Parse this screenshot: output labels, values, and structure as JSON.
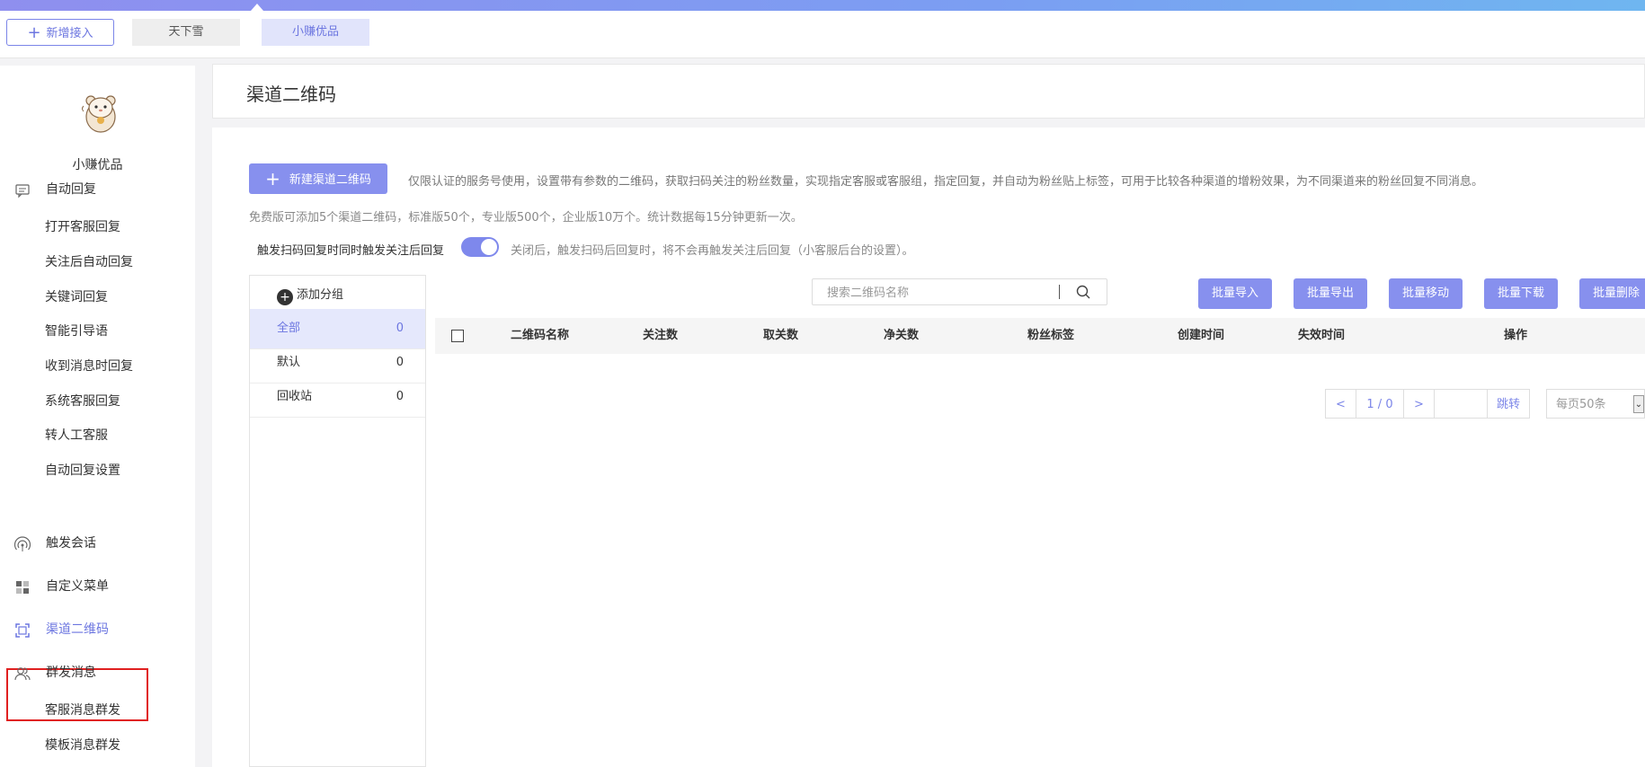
{
  "tabs": {
    "add_label": "新增接入",
    "items": [
      {
        "label": "天下雪"
      },
      {
        "label": "小赚优品"
      }
    ]
  },
  "sidebar": {
    "account_name": "小赚优品",
    "sections": [
      {
        "label": "自动回复",
        "icon": "chat-bubble-icon"
      },
      {
        "label": "触发会话",
        "icon": "broadcast-signal-icon"
      },
      {
        "label": "自定义菜单",
        "icon": "grid-menu-icon"
      },
      {
        "label": "渠道二维码",
        "icon": "qr-scan-icon"
      },
      {
        "label": "群发消息",
        "icon": "users-icon"
      }
    ],
    "auto_reply_items": [
      "打开客服回复",
      "关注后自动回复",
      "关键词回复",
      "智能引导语",
      "收到消息时回复",
      "系统客服回复",
      "转人工客服",
      "自动回复设置"
    ],
    "mass_items": [
      "客服消息群发",
      "模板消息群发"
    ]
  },
  "page": {
    "title": "渠道二维码",
    "new_button": "新建渠道二维码",
    "desc1": "仅限认证的服务号使用，设置带有参数的二维码，获取扫码关注的粉丝数量，实现指定客服或客服组，指定回复，并自动为粉丝贴上标签，可用于比较各种渠道的增粉效果，为不同渠道来的粉丝回复不同消息。",
    "desc2": "免费版可添加5个渠道二维码，标准版50个，专业版500个，企业版10万个。统计数据每15分钟更新一次。",
    "toggle_label": "触发扫码回复时同时触发关注后回复",
    "toggle_on": true,
    "toggle_note": "关闭后，触发扫码后回复时，将不会再触发关注后回复（小客服后台的设置）。"
  },
  "groups": {
    "add_label": "添加分组",
    "items": [
      {
        "name": "全部",
        "count": "0"
      },
      {
        "name": "默认",
        "count": "0"
      },
      {
        "name": "回收站",
        "count": "0"
      }
    ]
  },
  "search": {
    "placeholder": "搜索二维码名称",
    "value": ""
  },
  "batch_buttons": [
    "批量导入",
    "批量导出",
    "批量移动",
    "批量下载",
    "批量删除"
  ],
  "table": {
    "columns": [
      "二维码名称",
      "关注数",
      "取关数",
      "净关数",
      "粉丝标签",
      "创建时间",
      "失效时间",
      "操作"
    ],
    "rows": []
  },
  "pagination": {
    "prev": "<",
    "info": "1 / 0",
    "next": ">",
    "go": "跳转",
    "page_size": "每页50条"
  },
  "colors": {
    "accent": "#8790ee",
    "highlight_border": "#e02020"
  }
}
